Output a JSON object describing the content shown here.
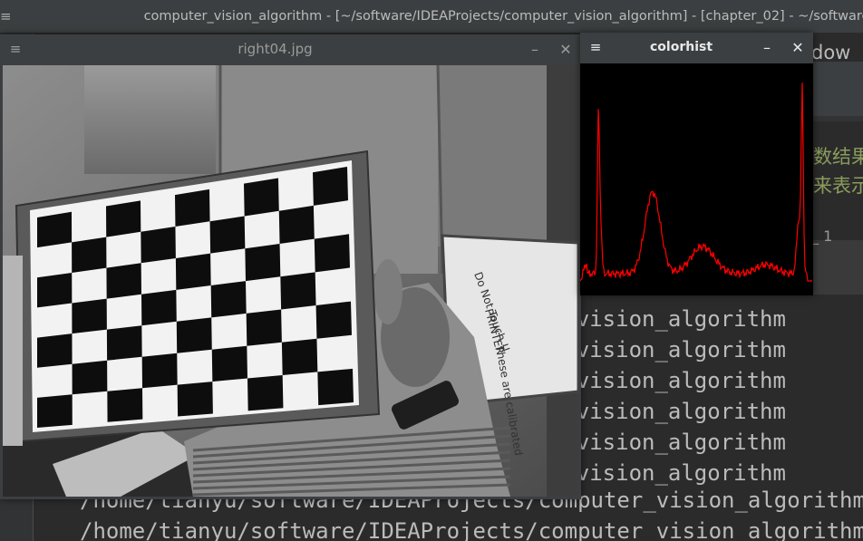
{
  "ide": {
    "title": "computer_vision_algorithm - [~/software/IDEAProjects/computer_vision_algorithm] - [chapter_02] - ~/software/",
    "panel_fragment": "dow",
    "cjk_line_1": "数结果",
    "cjk_line_2": "来表示",
    "dim_fragment": "_ 1",
    "console_lines": [
      "/home/tianyu/software/IDEAProjects/computer_vision_algorithm",
      "/home/tianyu/software/IDEAProjects/computer_vision_algorithm",
      "/home/tianyu/software/IDEAProjects/computer_vision_algorithm",
      "/home/tianyu/software/IDEAProjects/computer_vision_algorithm",
      "/home/tianyu/software/IDEAProjects/computer_vision_algorithm",
      "/home/tianyu/software/IDEAProjects/computer_vision_algorithm",
      "/home/tianyu/software/IDEAProjects/computer_vision_algorithm",
      "/home/tianyu/software/IDEAProjects/computer_vision_algorithm"
    ]
  },
  "image_window": {
    "title": "right04.jpg",
    "menu_icon": "hamburger-icon",
    "minimize_icon": "minimize-icon",
    "close_icon": "close-icon",
    "menu_glyph": "≡",
    "minimize_glyph": "–",
    "close_glyph": "✕",
    "whiteboard_text": [
      "Do Not Touch !!",
      "PRINTER",
      "These are calibrated"
    ]
  },
  "hist_window": {
    "title": "colorhist",
    "menu_glyph": "≡",
    "minimize_glyph": "–",
    "close_glyph": "✕",
    "line_color": "#ff0000",
    "background": "#000000"
  }
}
